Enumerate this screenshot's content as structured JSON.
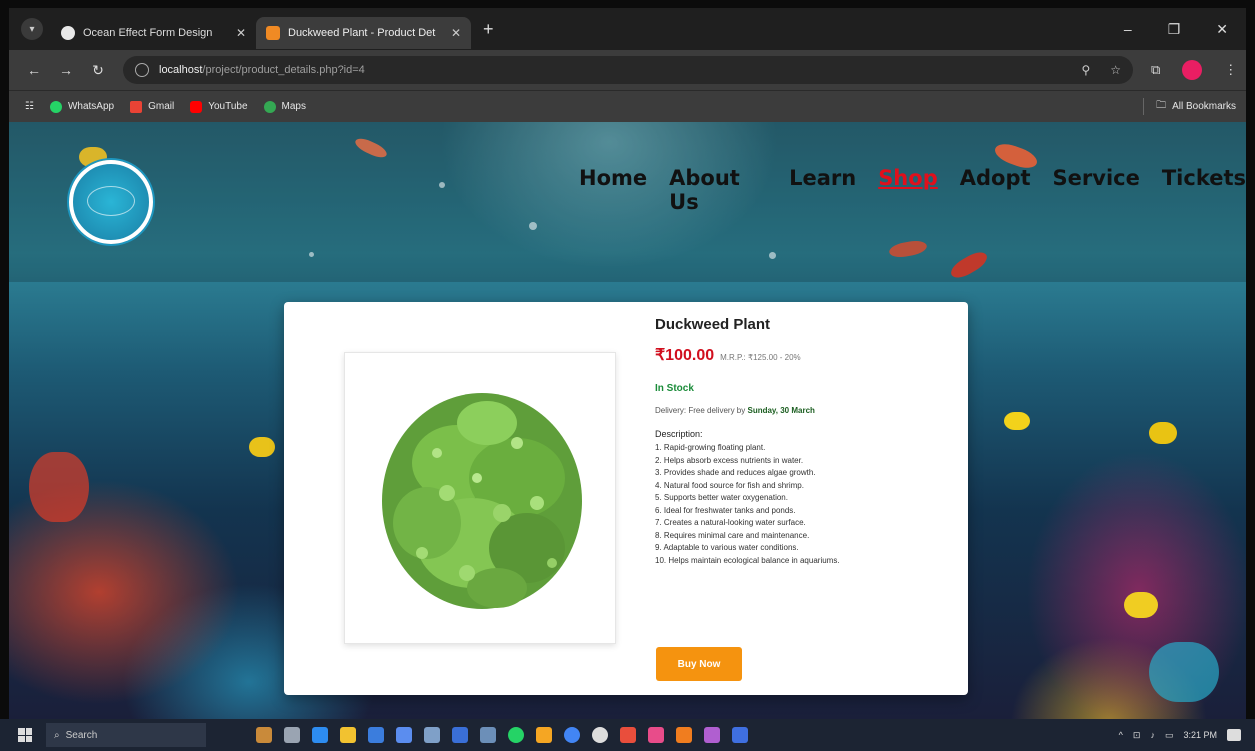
{
  "browser": {
    "tabs": [
      {
        "title": "Ocean Effect Form Design",
        "active": false
      },
      {
        "title": "Duckweed Plant - Product Det",
        "active": true
      }
    ],
    "url_host": "localhost",
    "url_path": "/project/product_details.php?id=4",
    "bookmarks": [
      "WhatsApp",
      "Gmail",
      "YouTube",
      "Maps"
    ],
    "all_bookmarks": "All Bookmarks"
  },
  "site": {
    "nav": [
      "Home",
      "About Us",
      "Learn",
      "Shop",
      "Adopt",
      "Service",
      "Tickets"
    ],
    "active_nav": "Shop"
  },
  "product": {
    "name": "Duckweed Plant",
    "price": "₹100.00",
    "mrp": "M.R.P.: ₹125.00 - 20%",
    "stock": "In Stock",
    "delivery_prefix": "Delivery: Free delivery by ",
    "delivery_date": "Sunday, 30 March",
    "description_heading": "Description:",
    "description": [
      "1. Rapid-growing floating plant.",
      "2. Helps absorb excess nutrients in water.",
      "3. Provides shade and reduces algae growth.",
      "4. Natural food source for fish and shrimp.",
      "5. Supports better water oxygenation.",
      "6. Ideal for freshwater tanks and ponds.",
      "7. Creates a natural-looking water surface.",
      "8. Requires minimal care and maintenance.",
      "9. Adaptable to various water conditions.",
      "10. Helps maintain ecological balance in aquariums."
    ],
    "buy_label": "Buy Now"
  },
  "taskbar": {
    "search_label": "Search",
    "time": "3:21 PM"
  }
}
